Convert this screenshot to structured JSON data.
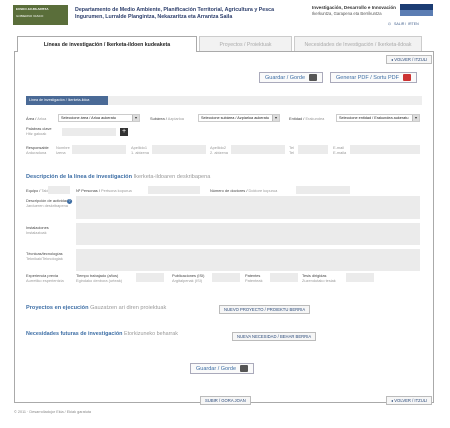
{
  "header": {
    "logo_line1": "EUSKO JAURLARITZA",
    "logo_line2": "GOBIERNO VASCO",
    "org_line1": "Departamento de Medio Ambiente, Planificación Territorial, Agricultura y Pesca",
    "org_line2": "Ingurumen, Lurralde Plangintza, Nekazaritza eta Arrantza Saila",
    "app_title": "Investigación, Desarrollo e Innovación",
    "app_subtitle": "Ikerkuntza, Garapena eta Berrikuntza",
    "links": [
      "SALIR",
      "IRTEN"
    ]
  },
  "tabs": [
    {
      "label": "Líneas de investigación / Ikerketa-ildoen kudeaketa"
    },
    {
      "label": "Proyectos / Proiektuak"
    },
    {
      "label": "Necesidades de Investigación / Ikerketa-ildoak"
    }
  ],
  "toolbar": {
    "volver_top": "VOLVER / ITZULI",
    "guardar": "Guardar / Gorde",
    "pdf": "Generar PDF / Sortu PDF"
  },
  "breadcrumb": "Línea de investigación / Ikerketa-ildoa",
  "form": {
    "area": {
      "label": "Área",
      "label_eu": "Arloa",
      "value": "Seleccione área / Arloa aukeratu"
    },
    "subarea": {
      "label": "Subárea",
      "label_eu": "Azpiarloa",
      "value": "Seleccione subárea / Azpiarloa aukeratu"
    },
    "entidad": {
      "label": "Entidad",
      "label_eu": "Erakundea",
      "value": "Seleccione entidad / Erakundea aukeratu"
    },
    "palabras": {
      "label": "Palabras clave",
      "label_eu": "Hitz gakoak"
    },
    "responsable": {
      "label": "Responsable",
      "label_eu": "Arduraduna",
      "fields": [
        {
          "es": "Nombre",
          "eu": "Izena"
        },
        {
          "es": "Apellido1",
          "eu": "1. abizena"
        },
        {
          "es": "Apellido2",
          "eu": "2. abizena"
        },
        {
          "es": "Tel",
          "eu": "Tel"
        },
        {
          "es": "E-mail",
          "eu": "E-maila"
        }
      ]
    }
  },
  "descripcion": {
    "title": "Descripción de la línea de investigación",
    "title_eu": "Ikerketa-ildoaren deskribapena",
    "equipo": {
      "label": "Equipo",
      "label_eu": "Taldea"
    },
    "personas": {
      "label": "Nº Personas",
      "label_eu": "Pertsona kopurua"
    },
    "doctores": {
      "label": "Número de doctores",
      "label_eu": "Doktore kopurua"
    },
    "actividades": {
      "label": "Descripción de actividades",
      "label_eu": "Jardueren deskribapena"
    },
    "instalaciones": {
      "label": "Instalaciones",
      "label_eu": "Instalazioak"
    },
    "tecnicas": {
      "label": "Técnicas/tecnologías",
      "label_eu": "Teknikak/Teknologiak"
    },
    "experiencia": {
      "label": "Experiencia previa",
      "label_eu": "Aurretiko esperientzia"
    },
    "tiempo": {
      "label": "Tiempo trabajado (años)",
      "label_eu": "Egindako denbora (urteak)"
    },
    "publicaciones": {
      "label": "Publicaciones (ISI)",
      "label_eu": "Argitalpenak (ISI)"
    },
    "patentes": {
      "label": "Patentes",
      "label_eu": "Patenteak"
    },
    "tesis": {
      "label": "Tesis dirigidas",
      "label_eu": "Zuzendutako tesiak"
    }
  },
  "proyectos": {
    "title": "Proyectos en ejecución",
    "title_eu": "Gauzatzen ari diren proiektuak",
    "button": "NUEVO PROYECTO / PROIEKTU BERRIA"
  },
  "necesidades": {
    "title": "Necesidades futuras de investigación",
    "title_eu": "Etorkizuneko beharrak",
    "button": "NUEVA NECESIDAD / BEHAR BERRIA"
  },
  "bottom": {
    "guardar": "Guardar / Gorde",
    "subir": "SUBIR / GORA JOAN",
    "volver": "VOLVER / ITZULI"
  },
  "footer": "© 2011 · Desarrolladojor Ekia / Ekiak garatuta"
}
